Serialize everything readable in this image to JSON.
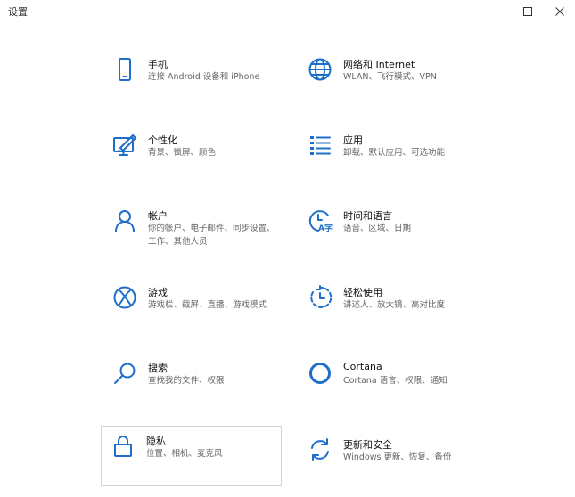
{
  "window": {
    "title": "设置"
  },
  "tiles": [
    {
      "id": "phone",
      "title": "手机",
      "desc": "连接 Android 设备和 iPhone",
      "icon": "phone-icon"
    },
    {
      "id": "network",
      "title": "网络和 Internet",
      "desc": "WLAN、飞行模式、VPN",
      "icon": "globe-icon"
    },
    {
      "id": "personalization",
      "title": "个性化",
      "desc": "背景、锁屏、颜色",
      "icon": "brush-monitor-icon"
    },
    {
      "id": "apps",
      "title": "应用",
      "desc": "卸载、默认应用、可选功能",
      "icon": "apps-list-icon"
    },
    {
      "id": "accounts",
      "title": "帐户",
      "desc": "你的帐户、电子邮件、同步设置、工作、其他人员",
      "icon": "person-icon"
    },
    {
      "id": "time-language",
      "title": "时间和语言",
      "desc": "语音、区域、日期",
      "icon": "time-language-icon"
    },
    {
      "id": "gaming",
      "title": "游戏",
      "desc": "游戏栏、截屏、直播、游戏模式",
      "icon": "xbox-icon"
    },
    {
      "id": "ease-of-access",
      "title": "轻松使用",
      "desc": "讲述人、放大镜、高对比度",
      "icon": "ease-of-access-icon"
    },
    {
      "id": "search",
      "title": "搜索",
      "desc": "查找我的文件、权限",
      "icon": "search-icon"
    },
    {
      "id": "cortana",
      "title": "Cortana",
      "desc": "Cortana 语言、权限、通知",
      "icon": "cortana-icon"
    },
    {
      "id": "privacy",
      "title": "隐私",
      "desc": "位置、相机、麦克风",
      "icon": "lock-icon"
    },
    {
      "id": "update-security",
      "title": "更新和安全",
      "desc": "Windows 更新、恢复、备份",
      "icon": "refresh-icon"
    }
  ],
  "accent_color": "#1e6fc9"
}
